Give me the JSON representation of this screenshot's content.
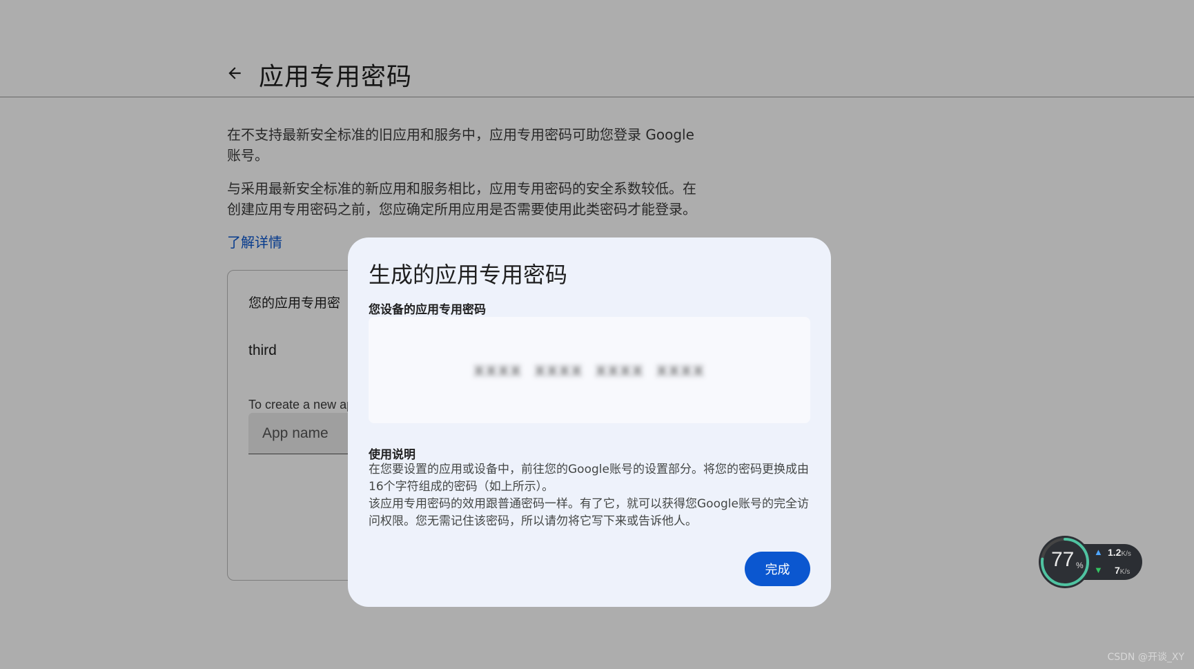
{
  "page": {
    "title": "应用专用密码",
    "intro_p1": "在不支持最新安全标准的旧应用和服务中，应用专用密码可助您登录 Google 账号。",
    "intro_p2": "与采用最新安全标准的新应用和服务相比，应用专用密码的安全系数较低。在创建应用专用密码之前，您应确定所用应用是否需要使用此类密码才能登录。",
    "learn_more": "了解详情",
    "card": {
      "label": "您的应用专用密",
      "existing_app": "third",
      "hint": "To create a new ap",
      "app_name_placeholder": "App name"
    }
  },
  "dialog": {
    "title": "生成的应用专用密码",
    "password_label": "您设备的应用专用密码",
    "password_value": "xxxx xxxx xxxx xxxx",
    "usage_title": "使用说明",
    "usage_line1": "在您要设置的应用或设备中，前往您的Google账号的设置部分。将您的密码更换成由16个字符组成的密码（如上所示）。",
    "usage_line2": "该应用专用密码的效用跟普通密码一样。有了它，就可以获得您Google账号的完全访问权限。您无需记住该密码，所以请勿将它写下来或告诉他人。",
    "done_label": "完成"
  },
  "net_widget": {
    "percent": "77",
    "percent_sign": "%",
    "upload": "1.2",
    "upload_unit": "K/s",
    "download": "7",
    "download_unit": "K/s",
    "ring_fraction": 0.77
  },
  "watermark": "CSDN @开谈_XY",
  "colors": {
    "accent": "#0b57d0",
    "dialog_bg": "#eef2fb",
    "scrim": "rgba(0,0,0,0.32)"
  }
}
